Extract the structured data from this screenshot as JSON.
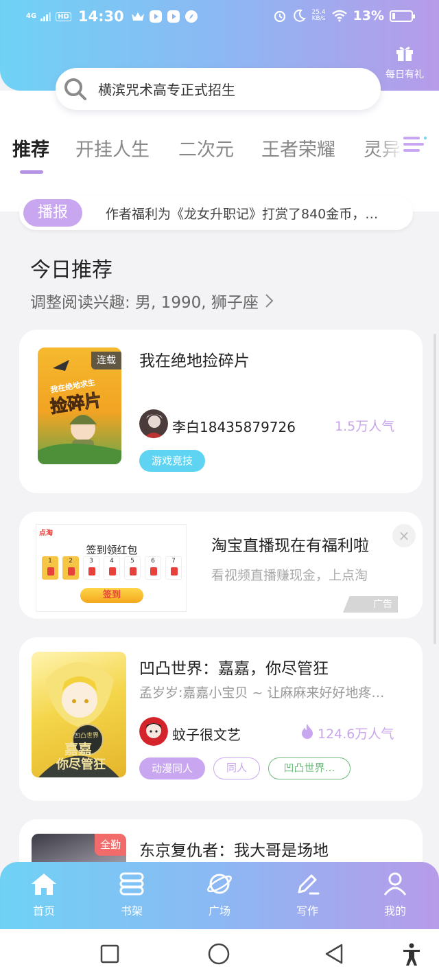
{
  "status_bar": {
    "network": "4G",
    "hd": "HD",
    "time": "14:30",
    "speed_value": "25.4",
    "speed_unit": "KB/s",
    "battery": "13%"
  },
  "header": {
    "gift_label": "每日有礼",
    "search_placeholder": "横滨咒术高专正式招生"
  },
  "tabs": [
    "推荐",
    "开挂人生",
    "二次元",
    "王者荣耀",
    "灵异"
  ],
  "broadcast": {
    "badge": "播报",
    "text": "作者福利为《龙女升职记》打赏了840金币，…"
  },
  "section": {
    "title": "今日推荐",
    "subtitle": "调整阅读兴趣: 男, 1990, 狮子座"
  },
  "books": [
    {
      "title": "我在绝地捡碎片",
      "badge": "连载",
      "cover_title": "捡碎片",
      "cover_sub": "我在绝地求生",
      "author": "李白18435879726",
      "popularity": "1.5万人气",
      "tags": [
        "游戏竞技"
      ]
    },
    {
      "title": "凹凸世界：嘉嘉，你尽管狂",
      "description": "孟岁岁:嘉嘉小宝贝 ~ 让麻麻来好好地疼…",
      "cover_title": "嘉嘉",
      "cover_sub": "你尽管狂",
      "cover_top": "凹凸世界",
      "author": "蚊子很文艺",
      "popularity": "124.6万人气",
      "tags": [
        "动漫同人",
        "同人",
        "凹凸世界…"
      ]
    },
    {
      "title": "东京复仇者：我大哥是场地",
      "badge": "全勤"
    }
  ],
  "ad": {
    "title": "淘宝直播现在有福利啦",
    "description": "看视频直播赚现金，上点淘",
    "label": "广告",
    "close": "×",
    "image": {
      "logo": "点淘",
      "heading": "签到领红包",
      "days": [
        "1",
        "2",
        "3",
        "4",
        "5",
        "6",
        "7"
      ],
      "button": "签到"
    }
  },
  "bottom_nav": [
    "首页",
    "书架",
    "广场",
    "写作",
    "我的"
  ],
  "colors": {
    "accent_purple": "#c9a7f0",
    "accent_blue": "#5ed4f2",
    "tag_green": "#6dbb7a"
  }
}
